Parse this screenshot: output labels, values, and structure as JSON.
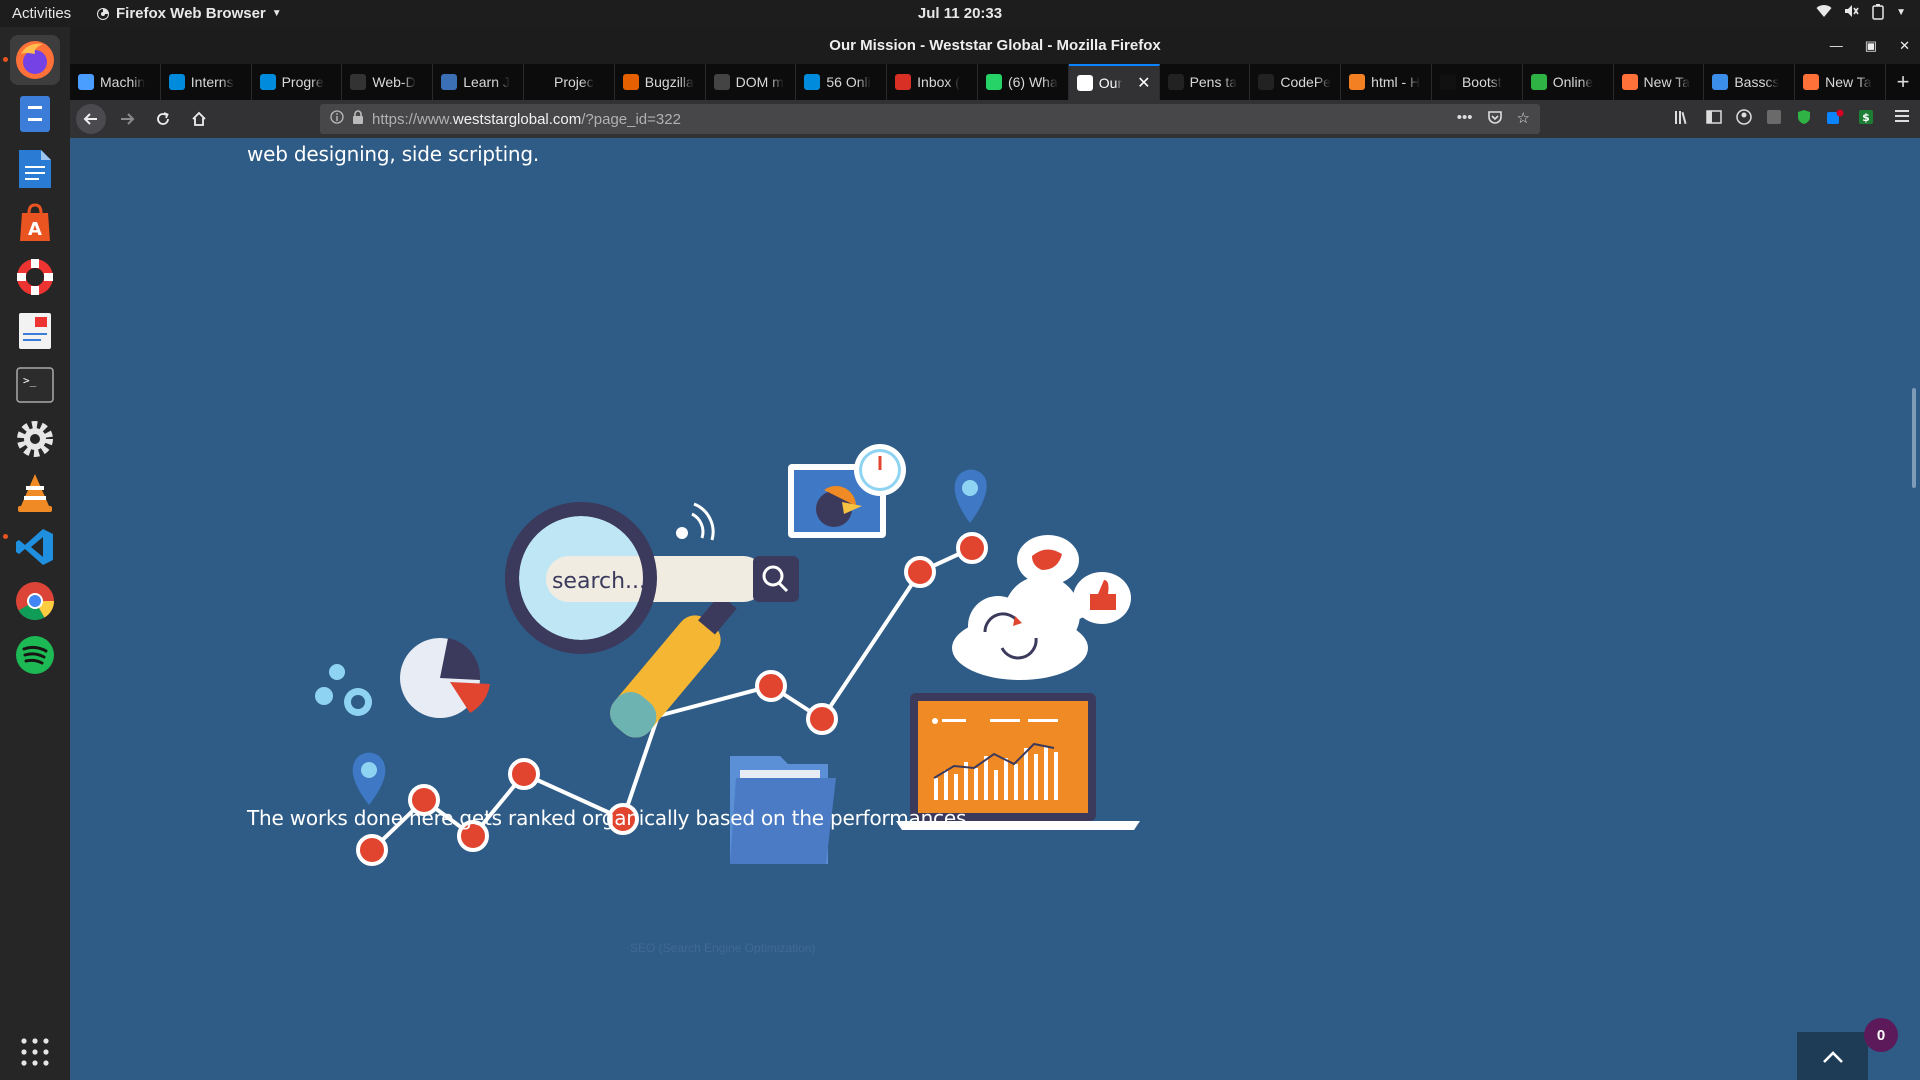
{
  "topbar": {
    "activities": "Activities",
    "app_name": "Firefox Web Browser",
    "clock": "Jul 11  20:33"
  },
  "window": {
    "title": "Our Mission - Weststar Global - Mozilla Firefox"
  },
  "tabs": [
    {
      "label": "Machin",
      "icon": "infinity-icon",
      "color": "#4a9eff"
    },
    {
      "label": "Interns",
      "icon": "internshala-icon",
      "color": "#008bdc"
    },
    {
      "label": "Progre",
      "icon": "internshala-icon",
      "color": "#008bdc"
    },
    {
      "label": "Web-D",
      "icon": "github-icon",
      "color": "#333333"
    },
    {
      "label": "Learn J",
      "icon": "globe-icon",
      "color": "#3b6fb6"
    },
    {
      "label": "Projec",
      "icon": "blank-icon",
      "color": "#0c0c0d"
    },
    {
      "label": "Bugzilla",
      "icon": "bugzilla-icon",
      "color": "#e66000"
    },
    {
      "label": "DOM m",
      "icon": "mdn-icon",
      "color": "#444444"
    },
    {
      "label": "56 Onli",
      "icon": "internshala-icon",
      "color": "#008bdc"
    },
    {
      "label": "Inbox (",
      "icon": "gmail-icon",
      "color": "#d93025"
    },
    {
      "label": "(6) Wha",
      "icon": "whatsapp-icon",
      "color": "#25d366"
    },
    {
      "label": "Our",
      "icon": "page-icon",
      "color": "#ffffff",
      "active": true
    },
    {
      "label": "Pens ta",
      "icon": "codepen-icon",
      "color": "#222222"
    },
    {
      "label": "CodePe",
      "icon": "codepen-icon",
      "color": "#222222"
    },
    {
      "label": "html - H",
      "icon": "stackoverflow-icon",
      "color": "#f48024"
    },
    {
      "label": "Bootst",
      "icon": "medium-icon",
      "color": "#111111"
    },
    {
      "label": "Online",
      "icon": "code-icon",
      "color": "#2fb344"
    },
    {
      "label": "New Ta",
      "icon": "firefox-icon",
      "color": "#ff7139"
    },
    {
      "label": "Basscs",
      "icon": "wave-icon",
      "color": "#3b8eea"
    },
    {
      "label": "New Ta",
      "icon": "firefox-icon",
      "color": "#ff7139"
    }
  ],
  "url": {
    "prefix": "https://www.",
    "host": "weststarglobal.com",
    "path": "/?page_id=322"
  },
  "page": {
    "para_top": "web designing, side scripting.",
    "illustration_search_text": "search...",
    "illustration_caption": "SEO (Search Engine Optimization)",
    "para_bottom": "The works done here gets ranked organically based on the performances.",
    "notification_count": "0"
  },
  "colors": {
    "page_background": "#2f5c87",
    "accent_red": "#e1452f",
    "accent_orange": "#f08a24",
    "tab_highlight": "#0a84ff"
  }
}
